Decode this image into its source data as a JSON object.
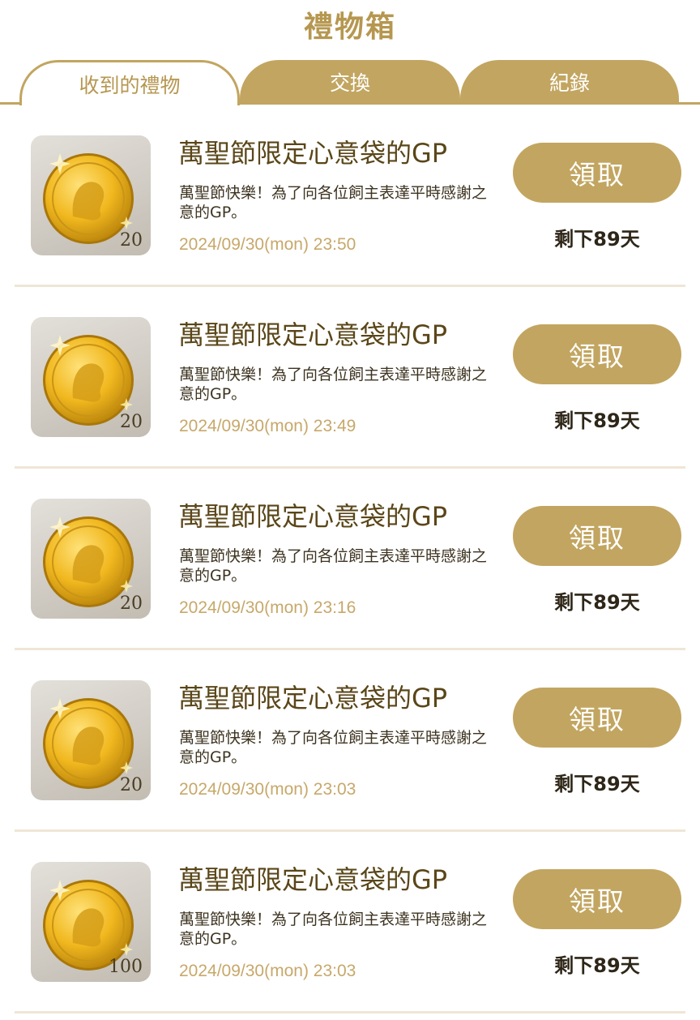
{
  "header": {
    "title": "禮物箱"
  },
  "tabs": [
    {
      "label": "收到的禮物",
      "active": true
    },
    {
      "label": "交換",
      "active": false
    },
    {
      "label": "紀錄",
      "active": false
    }
  ],
  "colors": {
    "accent": "#c2a560",
    "text_gold": "#b69750",
    "timestamp": "#c7a86a"
  },
  "gifts": [
    {
      "icon": "gold-coin-icon",
      "quantity": "20",
      "name": "萬聖節限定心意袋的GP",
      "description": "萬聖節快樂！為了向各位飼主表達平時感謝之意的GP。",
      "timestamp": "2024/09/30(mon) 23:50",
      "claim_label": "領取",
      "remaining": "剩下89天"
    },
    {
      "icon": "gold-coin-icon",
      "quantity": "20",
      "name": "萬聖節限定心意袋的GP",
      "description": "萬聖節快樂！為了向各位飼主表達平時感謝之意的GP。",
      "timestamp": "2024/09/30(mon) 23:49",
      "claim_label": "領取",
      "remaining": "剩下89天"
    },
    {
      "icon": "gold-coin-icon",
      "quantity": "20",
      "name": "萬聖節限定心意袋的GP",
      "description": "萬聖節快樂！為了向各位飼主表達平時感謝之意的GP。",
      "timestamp": "2024/09/30(mon) 23:16",
      "claim_label": "領取",
      "remaining": "剩下89天"
    },
    {
      "icon": "gold-coin-icon",
      "quantity": "20",
      "name": "萬聖節限定心意袋的GP",
      "description": "萬聖節快樂！為了向各位飼主表達平時感謝之意的GP。",
      "timestamp": "2024/09/30(mon) 23:03",
      "claim_label": "領取",
      "remaining": "剩下89天"
    },
    {
      "icon": "gold-coin-icon",
      "quantity": "100",
      "name": "萬聖節限定心意袋的GP",
      "description": "萬聖節快樂！為了向各位飼主表達平時感謝之意的GP。",
      "timestamp": "2024/09/30(mon) 23:03",
      "claim_label": "領取",
      "remaining": "剩下89天"
    }
  ]
}
